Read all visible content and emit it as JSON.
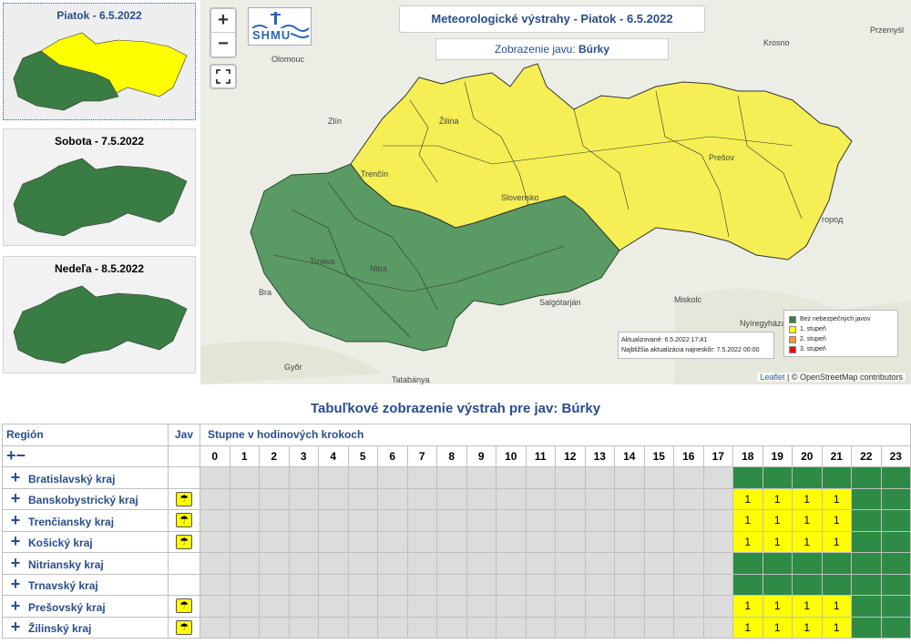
{
  "days": [
    {
      "label": "Piatok - 6.5.2022",
      "active": true
    },
    {
      "label": "Sobota - 7.5.2022",
      "active": false
    },
    {
      "label": "Nedeľa - 8.5.2022",
      "active": false
    }
  ],
  "map": {
    "zoom_in": "+",
    "zoom_out": "−",
    "logo_text": "SHMU",
    "title": "Meteorologické výstrahy - Piatok - 6.5.2022",
    "subtitle_prefix": "Zobrazenie javu: ",
    "subtitle_value": "Búrky",
    "updated": "Aktualizované: 6.5.2022 17:41",
    "next_update": "Najbližšia aktualizácia najneskôr: 7.5.2022 00:00",
    "legend": [
      {
        "label": "Bez nebezpečných javov",
        "color": "#3a7d44"
      },
      {
        "label": "1. stupeň",
        "color": "#ffff00"
      },
      {
        "label": "2. stupeň",
        "color": "#ff9933"
      },
      {
        "label": "3. stupeň",
        "color": "#ff0000"
      }
    ],
    "attribution_leaflet": "Leaflet",
    "attribution_rest": " | © OpenStreetMap contributors",
    "cities": {
      "olomouc": "Olomouc",
      "krosno": "Krosno",
      "przemysl": "Przemyśl",
      "zlin": "Zlín",
      "zilina": "Žilina",
      "trencin": "Trenčín",
      "presov": "Prešov",
      "slovensko": "Slovensko",
      "uzhorod": "горoд",
      "trnava": "Trnava",
      "nitra": "Nitra",
      "bratislava": "Bra",
      "salgotarjan": "Salgótarján",
      "miskolc": "Miskolc",
      "nyiregyhaza": "Nyíregyháza",
      "gyor": "Győr",
      "tatabanya": "Tatabánya"
    }
  },
  "table": {
    "title": "Tabuľkové zobrazenie výstrah pre jav: Búrky",
    "col_region": "Región",
    "col_jav": "Jav",
    "col_stupne": "Stupne v hodinových krokoch",
    "expand_all": "+−",
    "hours": [
      "0",
      "1",
      "2",
      "3",
      "4",
      "5",
      "6",
      "7",
      "8",
      "9",
      "10",
      "11",
      "12",
      "13",
      "14",
      "15",
      "16",
      "17",
      "18",
      "19",
      "20",
      "21",
      "22",
      "23"
    ],
    "rows": [
      {
        "name": "Bratislavský kraj",
        "icon": false,
        "levels": [
          0,
          0,
          0,
          0
        ]
      },
      {
        "name": "Banskobystrický kraj",
        "icon": true,
        "levels": [
          1,
          1,
          1,
          1
        ]
      },
      {
        "name": "Trenčiansky kraj",
        "icon": true,
        "levels": [
          1,
          1,
          1,
          1
        ]
      },
      {
        "name": "Košický kraj",
        "icon": true,
        "levels": [
          1,
          1,
          1,
          1
        ]
      },
      {
        "name": "Nitriansky kraj",
        "icon": false,
        "levels": [
          0,
          0,
          0,
          0
        ]
      },
      {
        "name": "Trnavský kraj",
        "icon": false,
        "levels": [
          0,
          0,
          0,
          0
        ]
      },
      {
        "name": "Prešovský kraj",
        "icon": true,
        "levels": [
          1,
          1,
          1,
          1
        ]
      },
      {
        "name": "Žilinský kraj",
        "icon": true,
        "levels": [
          1,
          1,
          1,
          1
        ]
      }
    ]
  },
  "colors": {
    "green": "#2e8b45",
    "map_green": "#3a7d44",
    "yellow": "#ffff00",
    "grey": "#dcdcdc",
    "accent": "#2a4d8b"
  }
}
